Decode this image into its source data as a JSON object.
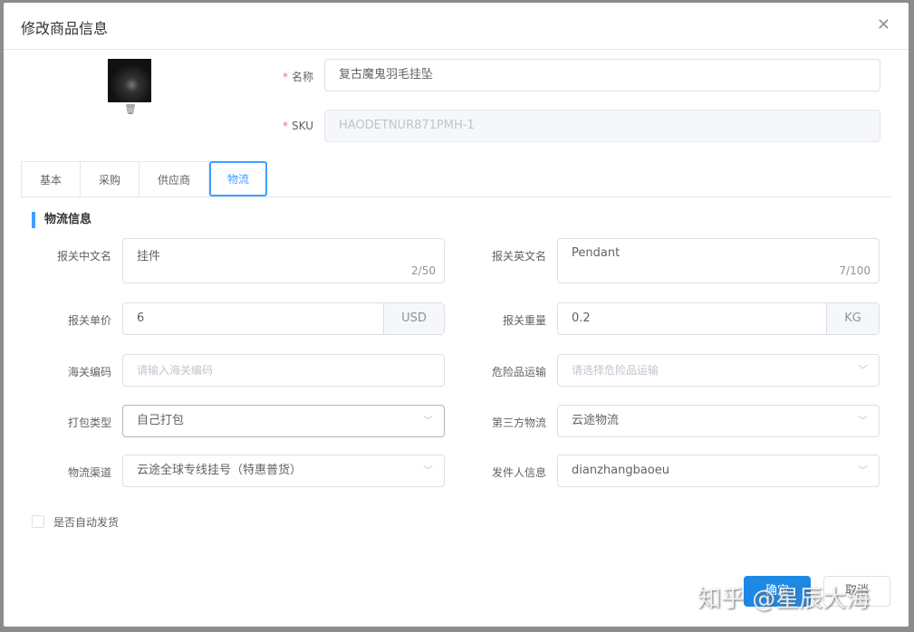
{
  "dialog": {
    "title": "修改商品信息"
  },
  "top": {
    "name_label": "名称",
    "name_value": "复古魔鬼羽毛挂坠",
    "sku_label": "SKU",
    "sku_value": "HAODETNUR871PMH-1",
    "req": "*"
  },
  "tabs": [
    "基本",
    "采购",
    "供应商",
    "物流"
  ],
  "section": "物流信息",
  "fields": {
    "cn_name": {
      "label": "报关中文名",
      "value": "挂件",
      "count": "2/50"
    },
    "en_name": {
      "label": "报关英文名",
      "value": "Pendant",
      "count": "7/100"
    },
    "price": {
      "label": "报关单价",
      "value": "6",
      "unit": "USD"
    },
    "weight": {
      "label": "报关重量",
      "value": "0.2",
      "unit": "KG"
    },
    "hs": {
      "label": "海关编码",
      "placeholder": "请输入海关编码"
    },
    "danger": {
      "label": "危险品运输",
      "placeholder": "请选择危险品运输"
    },
    "pack": {
      "label": "打包类型",
      "value": "自己打包"
    },
    "third": {
      "label": "第三方物流",
      "value": "云途物流"
    },
    "channel": {
      "label": "物流渠道",
      "value": "云途全球专线挂号（特惠普货）"
    },
    "sender": {
      "label": "发件人信息",
      "value": "dianzhangbaoeu"
    }
  },
  "auto_ship": {
    "label": "是否自动发货",
    "checked": false
  },
  "buttons": {
    "ok": "确定",
    "cancel": "取消"
  },
  "watermark": "知乎 @星辰大海"
}
